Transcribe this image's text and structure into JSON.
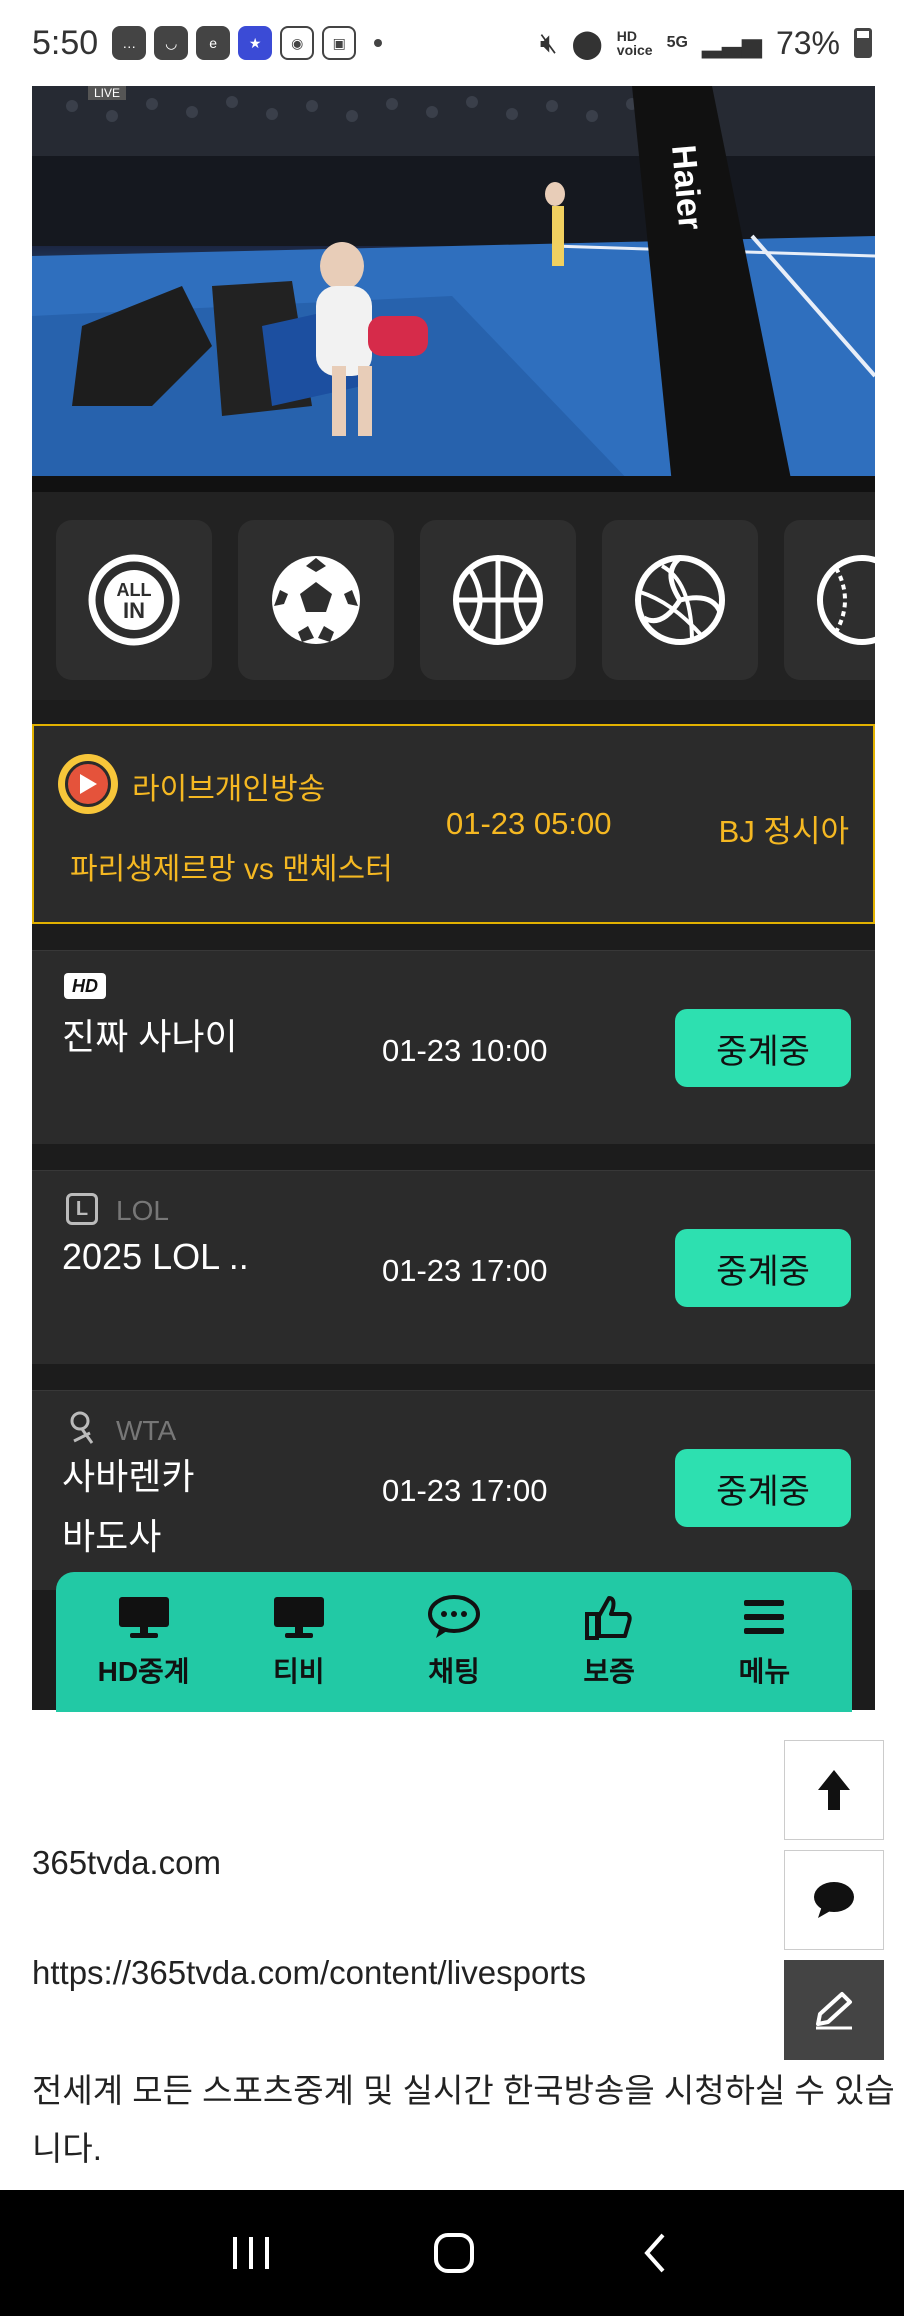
{
  "status_bar": {
    "time": "5:50",
    "battery": "73%",
    "signal": "5G",
    "hd_voice": "HD voice"
  },
  "video": {
    "live_badge": "LIVE",
    "watermark": "Haier"
  },
  "sports": [
    {
      "name": "all-in-icon",
      "label": "ALL IN"
    },
    {
      "name": "soccer-ball-icon"
    },
    {
      "name": "basketball-icon"
    },
    {
      "name": "volleyball-icon"
    },
    {
      "name": "baseball-icon"
    }
  ],
  "live_broadcast": {
    "label": "라이브개인방송",
    "match": "파리생제르망 vs 맨체스터",
    "time": "01-23 05:00",
    "broadcaster": "BJ 정시아"
  },
  "rows": [
    {
      "badge": "HD",
      "category": "",
      "title": "진짜 사나이",
      "time": "01-23 10:00",
      "status": "중계중"
    },
    {
      "badge": "L",
      "category": "LOL",
      "title": "2025 LOL ..",
      "time": "01-23 17:00",
      "status": "중계중"
    },
    {
      "badge": "",
      "category": "WTA",
      "title_line1": "사바렌카",
      "title_line2": "바도사",
      "time": "01-23 17:00",
      "status": "중계중"
    }
  ],
  "bottom_nav": [
    {
      "label": "HD중계",
      "icon": "monitor-icon"
    },
    {
      "label": "티비",
      "icon": "monitor-icon"
    },
    {
      "label": "채팅",
      "icon": "chat-icon"
    },
    {
      "label": "보증",
      "icon": "thumbs-up-icon"
    },
    {
      "label": "메뉴",
      "icon": "menu-icon"
    }
  ],
  "content": {
    "domain": "365tvda.com",
    "url": "https://365tvda.com/content/livesports",
    "description_line1": "전세계 모든 스포츠중계 및 실시간 한국방송을 시청하실 수 있습",
    "description_line2": "니다."
  },
  "colors": {
    "accent_green": "#2de0b0",
    "nav_green": "#22c9a5",
    "live_gold": "#f5b822"
  }
}
